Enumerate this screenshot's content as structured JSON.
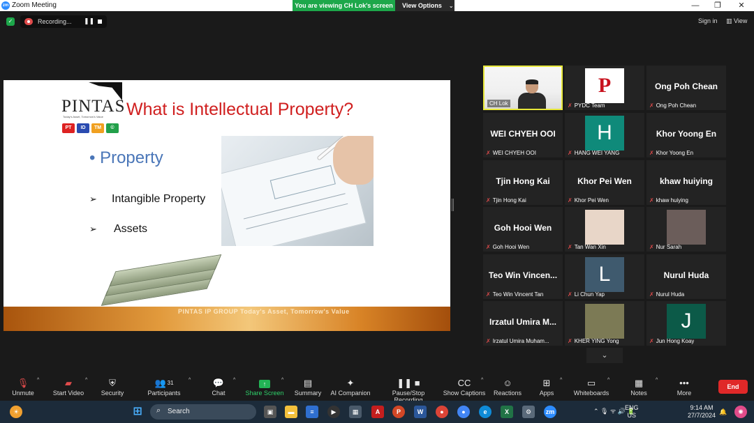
{
  "window": {
    "title": "Zoom Meeting",
    "app_icon": "zoom",
    "minimize": "—",
    "restore": "❐",
    "close": "✕"
  },
  "banner": {
    "viewing_text": "You are viewing CH Lok's screen",
    "view_options": "View Options",
    "view_options_chevron": "⌄"
  },
  "topbar": {
    "recording_label": "Recording...",
    "pause_glyph": "❚❚",
    "sign_in": "Sign in",
    "view": "View",
    "view_glyph": "▥"
  },
  "slide": {
    "logo_text": "PINTAS",
    "logo_tagline": "Today's Asset, Tomorrow's Value",
    "badges": [
      {
        "text": "PT",
        "color": "#d22"
      },
      {
        "text": "ID",
        "color": "#2a4bb0"
      },
      {
        "text": "TM",
        "color": "#f0a020"
      },
      {
        "text": "©",
        "color": "#22a04a"
      }
    ],
    "title": "What is Intellectual Property?",
    "bullet": "• Property",
    "sub_bullets": [
      {
        "arrow": "➢",
        "text": "Intangible Property"
      },
      {
        "arrow": "➢",
        "text": "Assets"
      }
    ],
    "footer_text": "PINTAS IP GROUP Today's Asset, Tomorrow's Value"
  },
  "gallery": {
    "tiles": [
      {
        "display": "video",
        "label": "CH Lok",
        "muted": false,
        "active": true
      },
      {
        "display": "logo",
        "letter": "P",
        "bg": "#ffffff",
        "letter_color": "#c8121e",
        "label": "PYDC Team",
        "muted": true
      },
      {
        "display": "name",
        "center": "Ong Poh Chean",
        "label": "Ong Poh Chean",
        "muted": true
      },
      {
        "display": "name",
        "center": "WEI CHYEH OOI",
        "label": "WEI CHYEH OOI",
        "muted": true
      },
      {
        "display": "letter",
        "letter": "H",
        "bg": "#0f8a7a",
        "label": "HANG WEI YANG",
        "muted": true
      },
      {
        "display": "name",
        "center": "Khor Yoong En",
        "label": "Khor Yoong En",
        "muted": true
      },
      {
        "display": "name",
        "center": "Tjin Hong Kai",
        "label": "Tjin Hong Kai",
        "muted": true
      },
      {
        "display": "name",
        "center": "Khor Pei Wen",
        "label": "Khor Pei Wen",
        "muted": true
      },
      {
        "display": "name",
        "center": "khaw huiying",
        "label": "khaw huiying",
        "muted": true
      },
      {
        "display": "name",
        "center": "Goh Hooi Wen",
        "label": "Goh Hooi Wen",
        "muted": true
      },
      {
        "display": "photo",
        "bg": "#e8d6c8",
        "label": "Tan Wan Xin",
        "muted": true
      },
      {
        "display": "photo",
        "bg": "#6b5d5a",
        "label": "Nur Sarah",
        "muted": true
      },
      {
        "display": "name",
        "center": "Teo Win Vincen...",
        "label": "Teo Win Vincent Tan",
        "muted": true
      },
      {
        "display": "letter",
        "letter": "L",
        "bg": "#3f5a6e",
        "label": "Li Chun Yap",
        "muted": true
      },
      {
        "display": "name",
        "center": "Nurul Huda",
        "label": "Nurul Huda",
        "muted": true
      },
      {
        "display": "name",
        "center": "Irzatul Umira M...",
        "label": "Irzatul Umira Muham...",
        "muted": true
      },
      {
        "display": "photo",
        "bg": "#7c7a55",
        "label": "KHER YING Yong",
        "muted": true
      },
      {
        "display": "letter",
        "letter": "J",
        "bg": "#0c5a48",
        "label": "Jun Hong Koay",
        "muted": true
      }
    ],
    "scroll_glyph": "⌄"
  },
  "toolbar": {
    "items": [
      {
        "key": "unmute",
        "label": "Unmute",
        "icon": "mic-muted-icon",
        "glyph": "🎙",
        "caret": true
      },
      {
        "key": "video",
        "label": "Start Video",
        "icon": "video-off-icon",
        "glyph": "▰",
        "caret": true
      },
      {
        "key": "security",
        "label": "Security",
        "icon": "shield-icon",
        "glyph": "⛨",
        "caret": false
      },
      {
        "key": "participants",
        "label": "Participants",
        "icon": "participants-icon",
        "glyph": "👥",
        "count": "31",
        "caret": true
      },
      {
        "key": "chat",
        "label": "Chat",
        "icon": "chat-icon",
        "glyph": "💬",
        "caret": true
      },
      {
        "key": "share",
        "label": "Share Screen",
        "icon": "share-screen-icon",
        "glyph": "↑",
        "caret": true
      },
      {
        "key": "summary",
        "label": "Summary",
        "icon": "summary-icon",
        "glyph": "▤",
        "caret": false
      },
      {
        "key": "ai",
        "label": "AI Companion",
        "icon": "ai-companion-icon",
        "glyph": "✦",
        "caret": false
      },
      {
        "key": "recording",
        "label": "Pause/Stop Recording",
        "icon": "pause-stop-recording-icon",
        "glyph": "❚❚ ■",
        "caret": false
      },
      {
        "key": "captions",
        "label": "Show Captions",
        "icon": "captions-icon",
        "glyph": "CC",
        "caret": true
      },
      {
        "key": "reactions",
        "label": "Reactions",
        "icon": "reactions-icon",
        "glyph": "☺",
        "caret": false
      },
      {
        "key": "apps",
        "label": "Apps",
        "icon": "apps-icon",
        "glyph": "⊞",
        "caret": true
      },
      {
        "key": "whiteboards",
        "label": "Whiteboards",
        "icon": "whiteboard-icon",
        "glyph": "▭",
        "caret": true
      },
      {
        "key": "notes",
        "label": "Notes",
        "icon": "notes-icon",
        "glyph": "▦",
        "caret": true
      },
      {
        "key": "more",
        "label": "More",
        "icon": "more-icon",
        "glyph": "•••",
        "caret": false
      }
    ],
    "caret_glyph": "^",
    "end_label": "End"
  },
  "taskbar": {
    "search_label": "Search",
    "search_glyph": "⌕",
    "tray_lang_1": "ENG",
    "tray_lang_2": "US",
    "time": "9:14 AM",
    "date": "27/7/2024",
    "tray_glyphs": "⌃  🎙  ᯤ  🔊  🔋"
  }
}
